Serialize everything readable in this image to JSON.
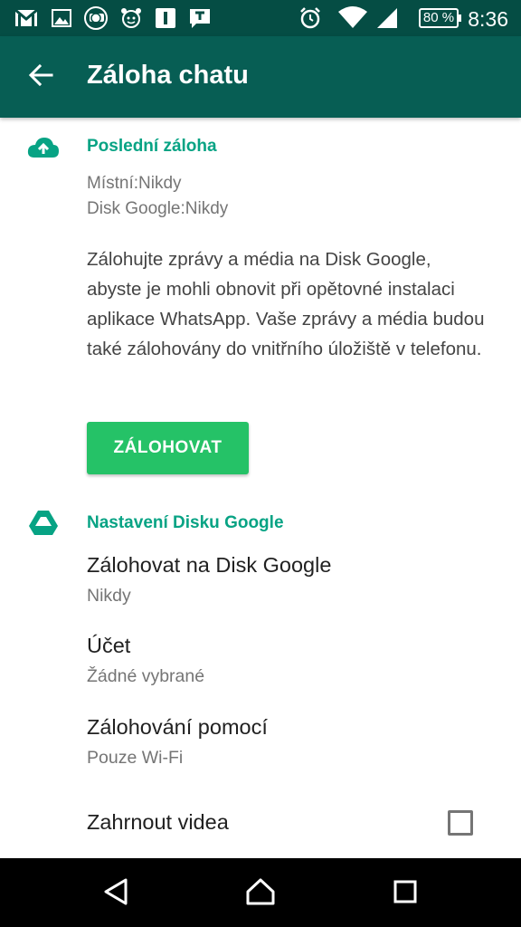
{
  "status_bar": {
    "time": "8:36",
    "battery_label": "80 %",
    "icons": [
      "gmail-icon",
      "gallery-icon",
      "app-badge-icon",
      "alarm-app-icon",
      "info-icon",
      "message-icon",
      "alarm-clock-icon",
      "wifi-icon",
      "signal-icon",
      "battery-icon"
    ]
  },
  "app_bar": {
    "title": "Záloha chatu",
    "back_icon": "arrow-left-icon"
  },
  "last_backup": {
    "icon": "cloud-upload-icon",
    "title": "Poslední záloha",
    "local": "Místní:Nikdy",
    "drive": "Disk Google:Nikdy",
    "description": "Zálohujte zprávy a média na Disk Google, abyste je mohli obnovit při opětovné instalaci aplikace WhatsApp. Vaše zprávy a média budou také zálohovány do vnitřního úložiště v telefonu.",
    "button_label": "ZÁLOHOVAT"
  },
  "drive_settings": {
    "icon": "google-drive-icon",
    "title": "Nastavení Disku Google",
    "items": [
      {
        "title": "Zálohovat na Disk Google",
        "subtitle": "Nikdy"
      },
      {
        "title": "Účet",
        "subtitle": "Žádné vybrané"
      },
      {
        "title": "Zálohování pomocí",
        "subtitle": "Pouze Wi-Fi"
      }
    ],
    "include_videos": {
      "title": "Zahrnout videa",
      "checked": false
    }
  },
  "colors": {
    "status_bar": "#054d44",
    "app_bar": "#075e54",
    "accent": "#07a384",
    "button": "#25c267"
  },
  "nav_bar": {
    "icons": [
      "back-triangle-icon",
      "home-icon",
      "recents-icon"
    ]
  }
}
